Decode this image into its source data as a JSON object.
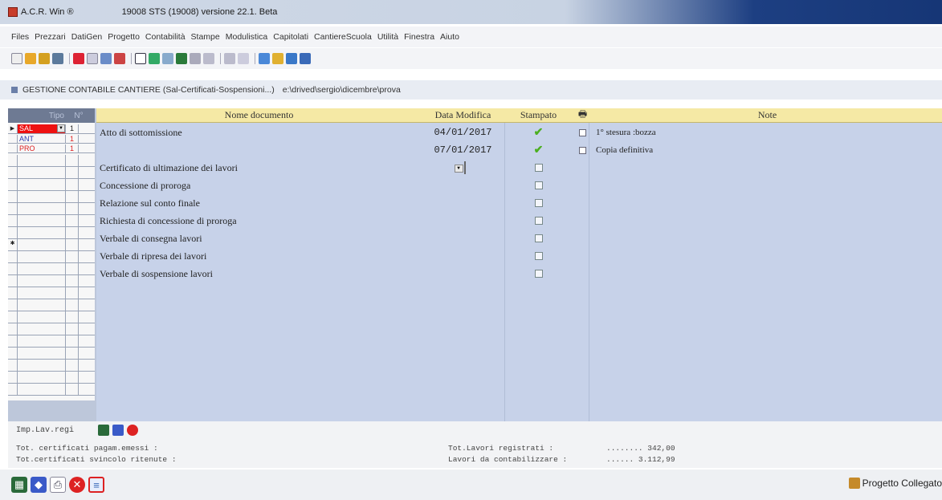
{
  "window": {
    "app_title": "A.C.R. Win ®",
    "version": "19008 STS (19008) versione 22.1. Beta"
  },
  "menu": [
    "Files",
    "Prezzari",
    "DatiGen",
    "Progetto",
    "Contabilità",
    "Stampe",
    "Modulistica",
    "Capitolati",
    "CantiereScuola",
    "Utilità",
    "Finestra",
    "Aiuto"
  ],
  "breadcrumb": {
    "title": "GESTIONE CONTABILE CANTIERE (Sal-Certificati-Sospensioni...)",
    "path": "e:\\drived\\sergio\\dicembre\\prova"
  },
  "left_grid": {
    "header_tipo": "Tipo",
    "header_n": "N°",
    "rows": [
      {
        "tipo": "SAL",
        "n": "1"
      },
      {
        "tipo": "ANT",
        "n": "1"
      },
      {
        "tipo": "PRO",
        "n": "1"
      }
    ]
  },
  "doc_grid": {
    "headers": {
      "name": "Nome documento",
      "date": "Data Modifica",
      "stamp": "Stampato",
      "note": "Note"
    },
    "rows": [
      {
        "name": "Atto di sottomissione",
        "date": "04/01/2017",
        "printed": true,
        "note": "1° stesura :bozza"
      },
      {
        "name": "",
        "date": "07/01/2017",
        "printed": true,
        "note": "Copia definitiva"
      },
      {
        "name": "Certificato di ultimazione dei lavori",
        "date": "",
        "printed": false,
        "note": ""
      },
      {
        "name": "Concessione di proroga",
        "date": "",
        "printed": false,
        "note": ""
      },
      {
        "name": "Relazione sul conto finale",
        "date": "",
        "printed": false,
        "note": ""
      },
      {
        "name": "Richiesta di concessione di proroga",
        "date": "",
        "printed": false,
        "note": ""
      },
      {
        "name": "Verbale di consegna lavori",
        "date": "",
        "printed": false,
        "note": ""
      },
      {
        "name": "Verbale di ripresa dei lavori",
        "date": "",
        "printed": false,
        "note": ""
      },
      {
        "name": "Verbale di sospensione lavori",
        "date": "",
        "printed": false,
        "note": ""
      }
    ]
  },
  "status": {
    "imp_label": "Imp.Lav.regi",
    "line1_left": "Tot. certificati pagam.emessi      :",
    "line2_left": "Tot.certificati svincolo ritenute :",
    "line1_right": "Tot.Lavori registrati    :",
    "line1_value": "........  342,00",
    "line2_right": "Lavori da contabilizzare :",
    "line2_value": "......  3.112,99"
  },
  "linked_label": "Progetto Collegato",
  "colors": {
    "sal_tag": "#e11",
    "ant_text": "#2a3ab0",
    "pro_text": "#d22",
    "grid_bg": "#c7d2e9",
    "header_yellow": "#f5e9a5"
  }
}
